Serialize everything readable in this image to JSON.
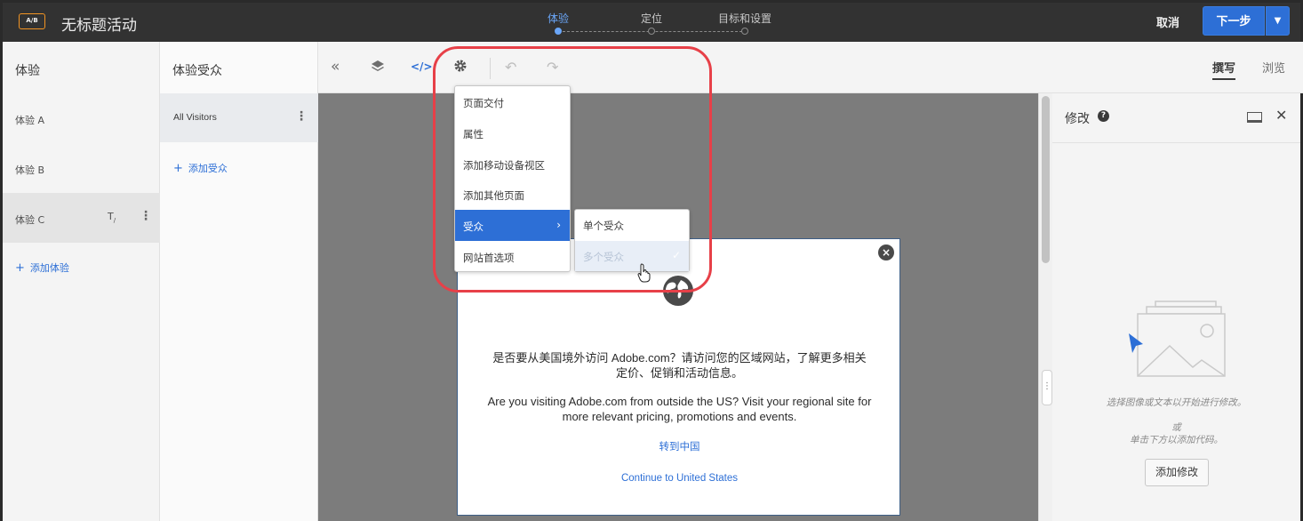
{
  "header": {
    "badge": "A/B",
    "title": "无标题活动",
    "steps": [
      {
        "label": "体验",
        "active": true
      },
      {
        "label": "定位",
        "active": false
      },
      {
        "label": "目标和设置",
        "active": false
      }
    ],
    "cancel_label": "取消",
    "next_label": "下一步"
  },
  "experiences": {
    "heading": "体验",
    "items": [
      {
        "label": "体验 A",
        "selected": false
      },
      {
        "label": "体验 B",
        "selected": false
      },
      {
        "label": "体验 C",
        "selected": true
      }
    ],
    "add_label": "添加体验"
  },
  "audiences": {
    "heading": "体验受众",
    "items": [
      {
        "label": "All Visitors"
      }
    ],
    "add_label": "添加受众"
  },
  "toolbar": {
    "modes": [
      {
        "label": "撰写",
        "active": true
      },
      {
        "label": "浏览",
        "active": false
      }
    ]
  },
  "settings_menu": {
    "items": [
      {
        "label": "页面交付"
      },
      {
        "label": "属性"
      },
      {
        "label": "添加移动设备视区"
      },
      {
        "label": "添加其他页面"
      },
      {
        "label": "受众",
        "highlighted": true,
        "has_submenu": true
      },
      {
        "label": "网站首选项"
      }
    ],
    "submenu": [
      {
        "label": "单个受众"
      },
      {
        "label": "多个受众",
        "checked": true
      }
    ]
  },
  "modal": {
    "zh_text_line1": "是否要从美国境外访问 Adobe.com？请访问您的区域网站，了解更多相关",
    "zh_text_line2": "定价、促销和活动信息。",
    "en_text_line1": "Are you visiting Adobe.com from outside the US? Visit your regional site for",
    "en_text_line2": "more relevant pricing, promotions and events.",
    "link_china": "转到中国",
    "link_us": "Continue to United States"
  },
  "modifications": {
    "title": "修改",
    "help": "?",
    "hint_line1": "选择图像或文本以开始进行修改。",
    "hint_line2": "或",
    "hint_line3": "单击下方以添加代码。",
    "add_button": "添加修改"
  },
  "colors": {
    "accent": "#2d6fd6",
    "step_active": "#6aa6f8",
    "badge_border": "#f29423",
    "annotation": "#e74048",
    "topbar": "#323232"
  }
}
